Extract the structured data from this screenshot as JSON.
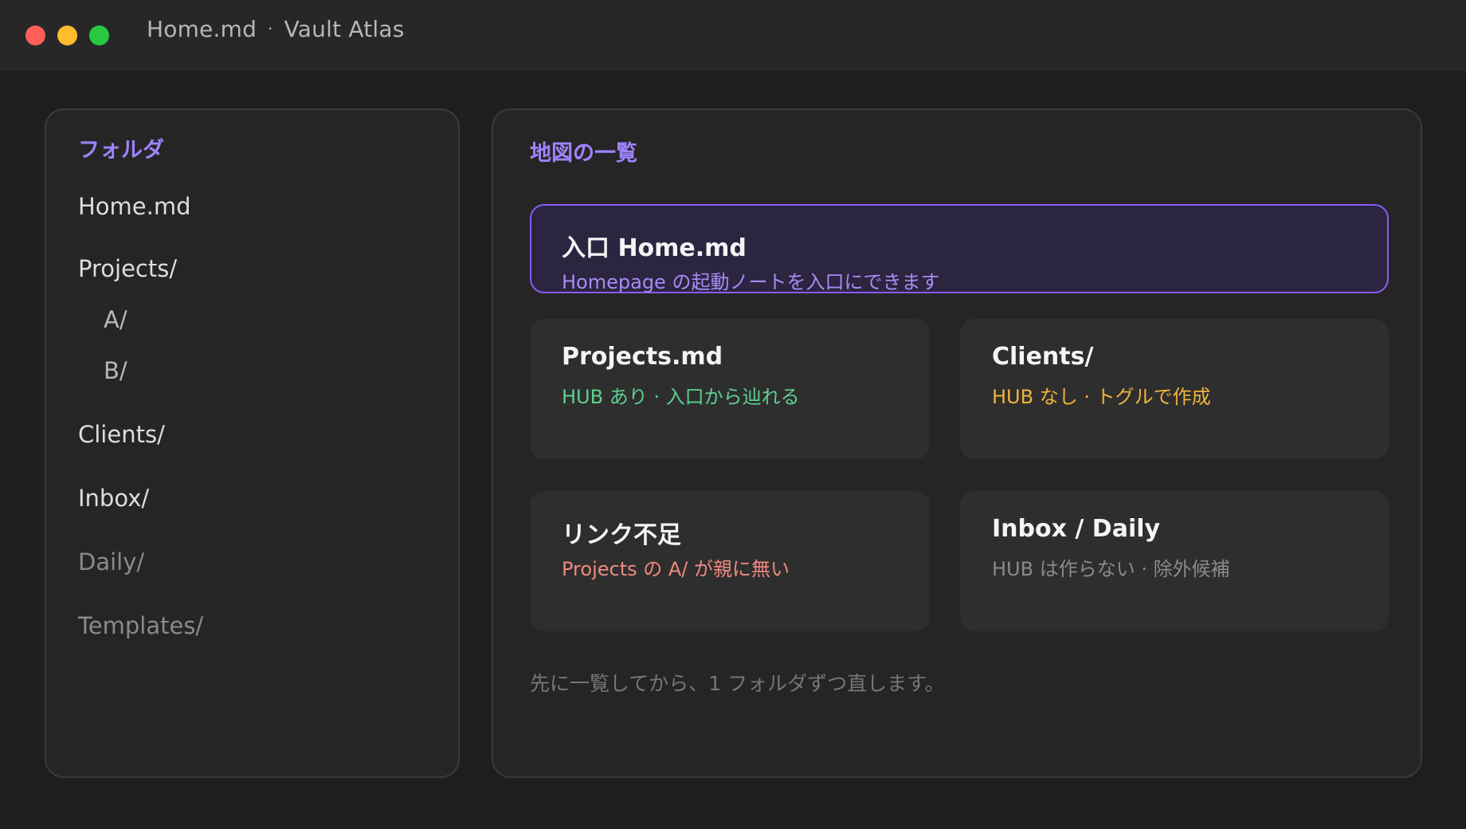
{
  "window": {
    "filename": "Home.md",
    "separator": "·",
    "vault_name": "Vault Atlas",
    "controls": {
      "close_color": "#ff5f57",
      "minimize_color": "#febc2e",
      "maximize_color": "#28c840"
    }
  },
  "sidebar": {
    "heading": "フォルダ",
    "items": [
      {
        "label": "Home.md"
      },
      {
        "label": "Projects/"
      },
      {
        "label": "A/"
      },
      {
        "label": "B/"
      },
      {
        "label": "Clients/"
      },
      {
        "label": "Inbox/"
      },
      {
        "label": "Daily/"
      },
      {
        "label": "Templates/"
      }
    ]
  },
  "main": {
    "heading": "地図の一覧",
    "hero": {
      "title": "入口  Home.md",
      "subtitle": "Homepage の起動ノートを入口にできます",
      "subtitle_color": "#a58cf5",
      "border_color": "#8a5cf6"
    },
    "cards": [
      {
        "title": "Projects.md",
        "subtitle": "HUB あり · 入口から辿れる",
        "color": "#5fcf8f"
      },
      {
        "title": "Clients/",
        "subtitle": "HUB なし · トグルで作成",
        "color": "#f0b43c"
      },
      {
        "title": "リンク不足",
        "subtitle": "Projects の A/ が親に無い",
        "color": "#ef8a80"
      },
      {
        "title": "Inbox / Daily",
        "subtitle": "HUB は作らない · 除外候補",
        "color": "#8a8a8a"
      }
    ],
    "footer_note": "先に一覧してから、1 フォルダずつ直します。"
  },
  "accent_color": "#9f83ff"
}
